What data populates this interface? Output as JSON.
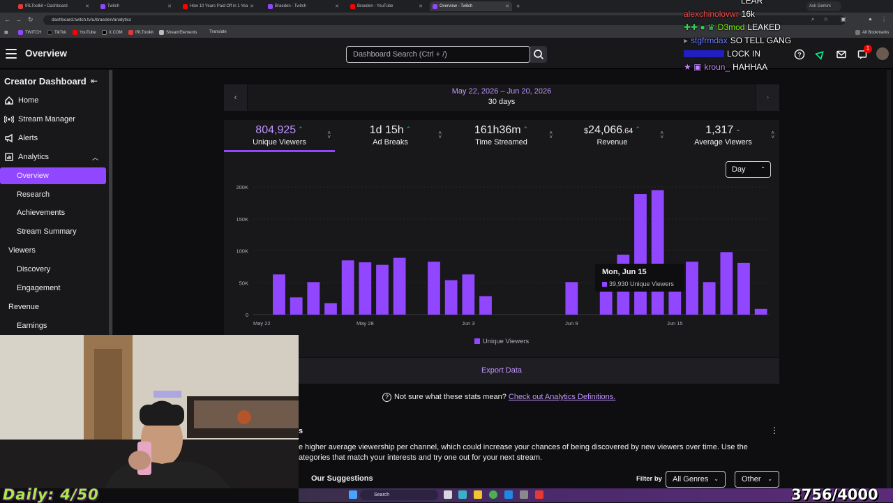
{
  "browser": {
    "tabs": [
      {
        "label": "IRLToolkit • Dashboard",
        "color": "#e03a3a"
      },
      {
        "label": "Twitch",
        "color": "#9147ff"
      },
      {
        "label": "How 10 Years Paid Off in 1 Yea",
        "color": "#ff0000"
      },
      {
        "label": "Braeden - Twitch",
        "color": "#9147ff"
      },
      {
        "label": "Braeden - YouTube",
        "color": "#ff0000"
      },
      {
        "label": "Overview - Twitch",
        "color": "#9147ff"
      }
    ],
    "url": "dashboard.twitch.tv/u/braeden/analytics",
    "ask_gemini": "Ask Gemini",
    "bookmarks": [
      "TWITCH",
      "TikTok",
      "YouTube",
      "X.COM",
      "IRLToolkit",
      "StreamElements",
      "Translate"
    ],
    "all_bookmarks": "All Bookmarks"
  },
  "topnav": {
    "title": "Overview",
    "search_placeholder": "Dashboard Search (Ctrl + /)",
    "notification_count": "1"
  },
  "sidebar": {
    "title": "Creator Dashboard",
    "items": [
      {
        "label": "Home"
      },
      {
        "label": "Stream Manager"
      },
      {
        "label": "Alerts"
      },
      {
        "label": "Analytics"
      },
      {
        "label": "Overview"
      },
      {
        "label": "Research"
      },
      {
        "label": "Achievements"
      },
      {
        "label": "Stream Summary"
      },
      {
        "label": "Viewers"
      },
      {
        "label": "Discovery"
      },
      {
        "label": "Engagement"
      },
      {
        "label": "Revenue"
      },
      {
        "label": "Earnings"
      }
    ]
  },
  "dates": {
    "range": "May 22, 2026 – Jun 20, 2026",
    "days": "30 days"
  },
  "stats": [
    {
      "value": "804,925",
      "label": "Unique Viewers",
      "trend": "up"
    },
    {
      "value": "1d 15h",
      "label": "Ad Breaks",
      "trend": "up"
    },
    {
      "value": "161h36m",
      "label": "Time Streamed",
      "trend": "up"
    },
    {
      "currency": "$",
      "value": "24,066",
      "cents": ".64",
      "label": "Revenue",
      "trend": "up"
    },
    {
      "value": "1,317",
      "label": "Average Viewers",
      "trend": "down"
    }
  ],
  "interval": "Day",
  "chart_data": {
    "type": "bar",
    "title": "",
    "xlabel": "",
    "ylabel": "",
    "ylim": [
      0,
      200000
    ],
    "yticks": [
      0,
      50000,
      100000,
      150000,
      200000
    ],
    "ytick_labels": [
      "0",
      "50K",
      "100K",
      "150K",
      "200K"
    ],
    "xtick_labels": [
      "May 22",
      "May 28",
      "Jun 3",
      "Jun 9",
      "Jun 15"
    ],
    "xtick_index": [
      0,
      6,
      12,
      18,
      24
    ],
    "categories": [
      "May 22",
      "May 23",
      "May 24",
      "May 25",
      "May 26",
      "May 27",
      "May 28",
      "May 29",
      "May 30",
      "May 31",
      "Jun 1",
      "Jun 2",
      "Jun 3",
      "Jun 4",
      "Jun 5",
      "Jun 6",
      "Jun 7",
      "Jun 8",
      "Jun 9",
      "Jun 10",
      "Jun 11",
      "Jun 12",
      "Jun 13",
      "Jun 14",
      "Jun 15",
      "Jun 16",
      "Jun 17",
      "Jun 18",
      "Jun 19",
      "Jun 20"
    ],
    "series": [
      {
        "name": "Unique Viewers",
        "color": "#9147ff",
        "values": [
          0,
          63000,
          27000,
          51000,
          18000,
          85000,
          82000,
          78000,
          89000,
          0,
          83000,
          54000,
          63000,
          29000,
          0,
          0,
          0,
          0,
          51000,
          0,
          36000,
          94000,
          189000,
          195000,
          39930,
          83000,
          51000,
          98000,
          81000,
          9000
        ]
      }
    ],
    "grid": true,
    "legend": "bottom-center"
  },
  "tooltip": {
    "title": "Mon, Jun 15",
    "value": "39,930 Unique Viewers"
  },
  "export_label": "Export Data",
  "definitions": {
    "text": "Not sure what these stats mean?",
    "link": "Check out Analytics Definitions."
  },
  "suggestions": {
    "heading_fragment": "s",
    "text": "e higher average viewership per channel, which could increase your chances of being discovered by new viewers over time. Use the ategories that match your interests and try one out for your next stream.",
    "our_suggestions": "Our Suggestions",
    "filter_by": "Filter by",
    "genre": "All Genres",
    "other": "Other"
  },
  "chat": [
    {
      "user": "",
      "message": "LEAR",
      "user_color": "#ff4040"
    },
    {
      "user": "alexchinolovwr",
      "message": "16k",
      "user_color": "#ff4d4d"
    },
    {
      "user": "D3mod",
      "message": "LEAKED",
      "user_color": "#7cfc00"
    },
    {
      "user": "stgfrmdax",
      "message": "SO TELL GANG",
      "user_color": "#6e7cff"
    },
    {
      "user": "",
      "message": "LOCK IN",
      "user_color": "#3a3aff"
    },
    {
      "user": "kroun_",
      "message": "HAHHAA",
      "user_color": "#c084fc"
    }
  ],
  "overlay": {
    "daily": "Daily: 4/50",
    "goal": "3756/4000"
  },
  "taskbar": {
    "search": "Search"
  }
}
